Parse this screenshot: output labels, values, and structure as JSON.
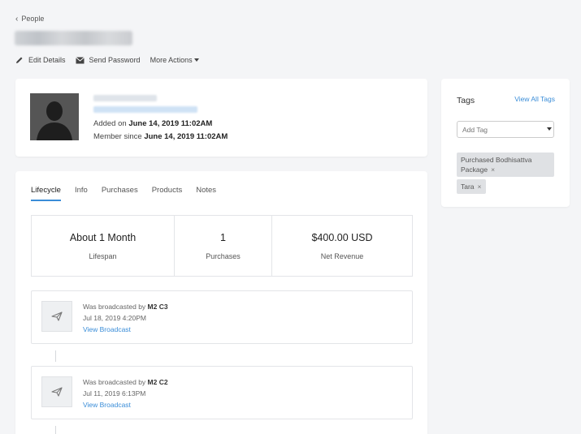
{
  "nav": {
    "back_label": "People"
  },
  "actions": {
    "edit": "Edit Details",
    "send_password": "Send Password",
    "more": "More Actions"
  },
  "profile": {
    "added_prefix": "Added on",
    "added_date": "June 14, 2019 11:02AM",
    "member_prefix": "Member since",
    "member_date": "June 14, 2019 11:02AM"
  },
  "tags": {
    "title": "Tags",
    "view_all": "View All Tags",
    "placeholder": "Add Tag",
    "chips": [
      {
        "line1": "Purchased Bodhisattva",
        "line2": "Package"
      },
      {
        "line1": "Tara"
      }
    ],
    "remove_glyph": "×"
  },
  "tabs": [
    "Lifecycle",
    "Info",
    "Purchases",
    "Products",
    "Notes"
  ],
  "active_tab": "Lifecycle",
  "stats": [
    {
      "value": "About 1 Month",
      "label": "Lifespan"
    },
    {
      "value": "1",
      "label": "Purchases"
    },
    {
      "value": "$400.00 USD",
      "label": "Net Revenue"
    }
  ],
  "broadcasts": [
    {
      "prefix": "Was broadcasted by",
      "name": "M2 C3",
      "date": "Jul 18, 2019 4:20PM",
      "link": "View Broadcast"
    },
    {
      "prefix": "Was broadcasted by",
      "name": "M2 C2",
      "date": "Jul 11, 2019 6:13PM",
      "link": "View Broadcast"
    }
  ],
  "colors": {
    "accent": "#3a8dd8",
    "background": "#f4f5f7"
  }
}
